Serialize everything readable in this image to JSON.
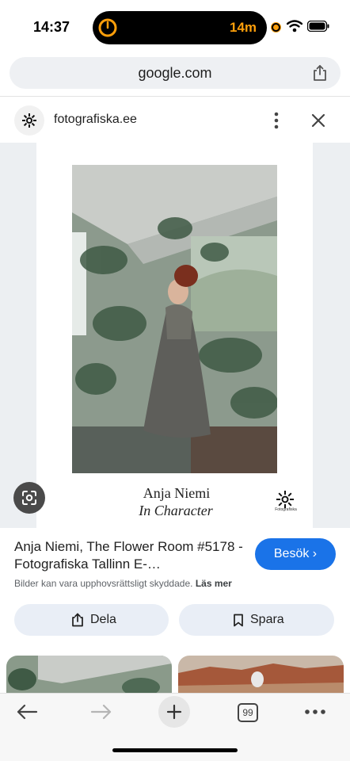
{
  "status_bar": {
    "time": "14:37",
    "activity_text": "14m",
    "accent_color": "#ff9f0a"
  },
  "browser": {
    "url": "google.com",
    "tabs_count": "99"
  },
  "site": {
    "name": "fotografiska.ee",
    "logo_icon": "snowflake-logo-icon"
  },
  "poster": {
    "artist": "Anja Niemi",
    "exhibition": "In Character",
    "logo_text": "Fotografiska"
  },
  "result": {
    "title": "Anja Niemi, The Flower Room #5178 - Fotografiska Tallinn E-…",
    "copyright_text": "Bilder kan vara upphovsrättsligt skyddade.",
    "learn_more": "Läs mer",
    "visit_label": "Besök",
    "accent_color": "#1a73e8"
  },
  "actions": {
    "share_label": "Dela",
    "save_label": "Spara"
  }
}
